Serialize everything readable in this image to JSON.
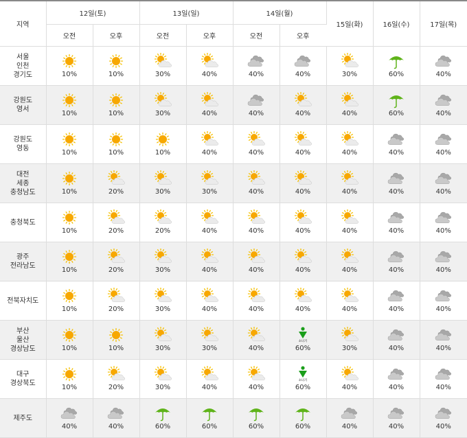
{
  "header": {
    "region_label": "지역",
    "am_label": "오전",
    "pm_label": "오후",
    "days": [
      "12일(토)",
      "13일(일)",
      "14일(월)",
      "15일(화)",
      "16일(수)",
      "17일(목)"
    ]
  },
  "shower_label": "소나기",
  "regions": [
    {
      "name": [
        "서울",
        "인천",
        "경기도"
      ],
      "cells": [
        {
          "icon": "sunny",
          "pct": "10%"
        },
        {
          "icon": "sunny",
          "pct": "10%"
        },
        {
          "icon": "partly-cloudy",
          "pct": "30%"
        },
        {
          "icon": "partly-cloudy",
          "pct": "40%"
        },
        {
          "icon": "cloudy",
          "pct": "40%"
        },
        {
          "icon": "cloudy",
          "pct": "40%"
        },
        {
          "icon": "partly-cloudy",
          "pct": "30%"
        },
        {
          "icon": "rain",
          "pct": "60%"
        },
        {
          "icon": "cloudy",
          "pct": "40%"
        }
      ]
    },
    {
      "name": [
        "강원도",
        "영서"
      ],
      "cells": [
        {
          "icon": "sunny",
          "pct": "10%"
        },
        {
          "icon": "sunny",
          "pct": "10%"
        },
        {
          "icon": "partly-cloudy",
          "pct": "30%"
        },
        {
          "icon": "partly-cloudy",
          "pct": "40%"
        },
        {
          "icon": "cloudy",
          "pct": "40%"
        },
        {
          "icon": "partly-cloudy",
          "pct": "40%"
        },
        {
          "icon": "partly-cloudy",
          "pct": "40%"
        },
        {
          "icon": "rain",
          "pct": "60%"
        },
        {
          "icon": "cloudy",
          "pct": "40%"
        }
      ]
    },
    {
      "name": [
        "강원도",
        "영동"
      ],
      "cells": [
        {
          "icon": "sunny",
          "pct": "10%"
        },
        {
          "icon": "sunny",
          "pct": "10%"
        },
        {
          "icon": "sunny",
          "pct": "10%"
        },
        {
          "icon": "partly-cloudy",
          "pct": "40%"
        },
        {
          "icon": "partly-cloudy",
          "pct": "40%"
        },
        {
          "icon": "partly-cloudy",
          "pct": "40%"
        },
        {
          "icon": "partly-cloudy",
          "pct": "40%"
        },
        {
          "icon": "cloudy",
          "pct": "40%"
        },
        {
          "icon": "cloudy",
          "pct": "40%"
        }
      ]
    },
    {
      "name": [
        "대전",
        "세종",
        "충청남도"
      ],
      "cells": [
        {
          "icon": "sunny",
          "pct": "10%"
        },
        {
          "icon": "partly-cloudy",
          "pct": "20%"
        },
        {
          "icon": "partly-cloudy",
          "pct": "30%"
        },
        {
          "icon": "partly-cloudy",
          "pct": "30%"
        },
        {
          "icon": "partly-cloudy",
          "pct": "40%"
        },
        {
          "icon": "partly-cloudy",
          "pct": "40%"
        },
        {
          "icon": "partly-cloudy",
          "pct": "40%"
        },
        {
          "icon": "cloudy",
          "pct": "40%"
        },
        {
          "icon": "cloudy",
          "pct": "40%"
        }
      ]
    },
    {
      "name": [
        "충청북도"
      ],
      "cells": [
        {
          "icon": "sunny",
          "pct": "10%"
        },
        {
          "icon": "partly-cloudy",
          "pct": "20%"
        },
        {
          "icon": "partly-cloudy",
          "pct": "20%"
        },
        {
          "icon": "partly-cloudy",
          "pct": "40%"
        },
        {
          "icon": "partly-cloudy",
          "pct": "40%"
        },
        {
          "icon": "partly-cloudy",
          "pct": "40%"
        },
        {
          "icon": "partly-cloudy",
          "pct": "40%"
        },
        {
          "icon": "cloudy",
          "pct": "40%"
        },
        {
          "icon": "cloudy",
          "pct": "40%"
        }
      ]
    },
    {
      "name": [
        "광주",
        "전라남도"
      ],
      "cells": [
        {
          "icon": "sunny",
          "pct": "10%"
        },
        {
          "icon": "partly-cloudy",
          "pct": "20%"
        },
        {
          "icon": "partly-cloudy",
          "pct": "30%"
        },
        {
          "icon": "partly-cloudy",
          "pct": "40%"
        },
        {
          "icon": "partly-cloudy",
          "pct": "40%"
        },
        {
          "icon": "partly-cloudy",
          "pct": "40%"
        },
        {
          "icon": "partly-cloudy",
          "pct": "40%"
        },
        {
          "icon": "cloudy",
          "pct": "40%"
        },
        {
          "icon": "cloudy",
          "pct": "40%"
        }
      ]
    },
    {
      "name": [
        "전북자치도"
      ],
      "cells": [
        {
          "icon": "sunny",
          "pct": "10%"
        },
        {
          "icon": "partly-cloudy",
          "pct": "20%"
        },
        {
          "icon": "partly-cloudy",
          "pct": "30%"
        },
        {
          "icon": "partly-cloudy",
          "pct": "40%"
        },
        {
          "icon": "partly-cloudy",
          "pct": "40%"
        },
        {
          "icon": "partly-cloudy",
          "pct": "40%"
        },
        {
          "icon": "partly-cloudy",
          "pct": "40%"
        },
        {
          "icon": "cloudy",
          "pct": "40%"
        },
        {
          "icon": "cloudy",
          "pct": "40%"
        }
      ]
    },
    {
      "name": [
        "부산",
        "울산",
        "경상남도"
      ],
      "cells": [
        {
          "icon": "sunny",
          "pct": "10%"
        },
        {
          "icon": "sunny",
          "pct": "10%"
        },
        {
          "icon": "partly-cloudy",
          "pct": "30%"
        },
        {
          "icon": "partly-cloudy",
          "pct": "30%"
        },
        {
          "icon": "partly-cloudy",
          "pct": "40%"
        },
        {
          "icon": "shower",
          "pct": "60%"
        },
        {
          "icon": "partly-cloudy",
          "pct": "30%"
        },
        {
          "icon": "cloudy",
          "pct": "40%"
        },
        {
          "icon": "cloudy",
          "pct": "40%"
        }
      ]
    },
    {
      "name": [
        "대구",
        "경상북도"
      ],
      "cells": [
        {
          "icon": "sunny",
          "pct": "10%"
        },
        {
          "icon": "partly-cloudy",
          "pct": "20%"
        },
        {
          "icon": "partly-cloudy",
          "pct": "30%"
        },
        {
          "icon": "partly-cloudy",
          "pct": "40%"
        },
        {
          "icon": "partly-cloudy",
          "pct": "40%"
        },
        {
          "icon": "shower",
          "pct": "60%"
        },
        {
          "icon": "partly-cloudy",
          "pct": "40%"
        },
        {
          "icon": "cloudy",
          "pct": "40%"
        },
        {
          "icon": "cloudy",
          "pct": "40%"
        }
      ]
    },
    {
      "name": [
        "제주도"
      ],
      "cells": [
        {
          "icon": "cloudy",
          "pct": "40%"
        },
        {
          "icon": "cloudy",
          "pct": "40%"
        },
        {
          "icon": "rain",
          "pct": "60%"
        },
        {
          "icon": "rain",
          "pct": "60%"
        },
        {
          "icon": "rain",
          "pct": "60%"
        },
        {
          "icon": "rain",
          "pct": "60%"
        },
        {
          "icon": "cloudy",
          "pct": "40%"
        },
        {
          "icon": "cloudy",
          "pct": "40%"
        },
        {
          "icon": "cloudy",
          "pct": "40%"
        }
      ]
    }
  ],
  "colors": {
    "sun": "#f7a800",
    "sun_rays": "#f5c000",
    "cloud": "#c9c9c9",
    "cloud_dark": "#a8a8a8",
    "umbrella": "#5fb31a",
    "shower_arrow": "#1a9e1a",
    "alt_row_bg": "#f0f0f0",
    "border": "#dddddd"
  }
}
